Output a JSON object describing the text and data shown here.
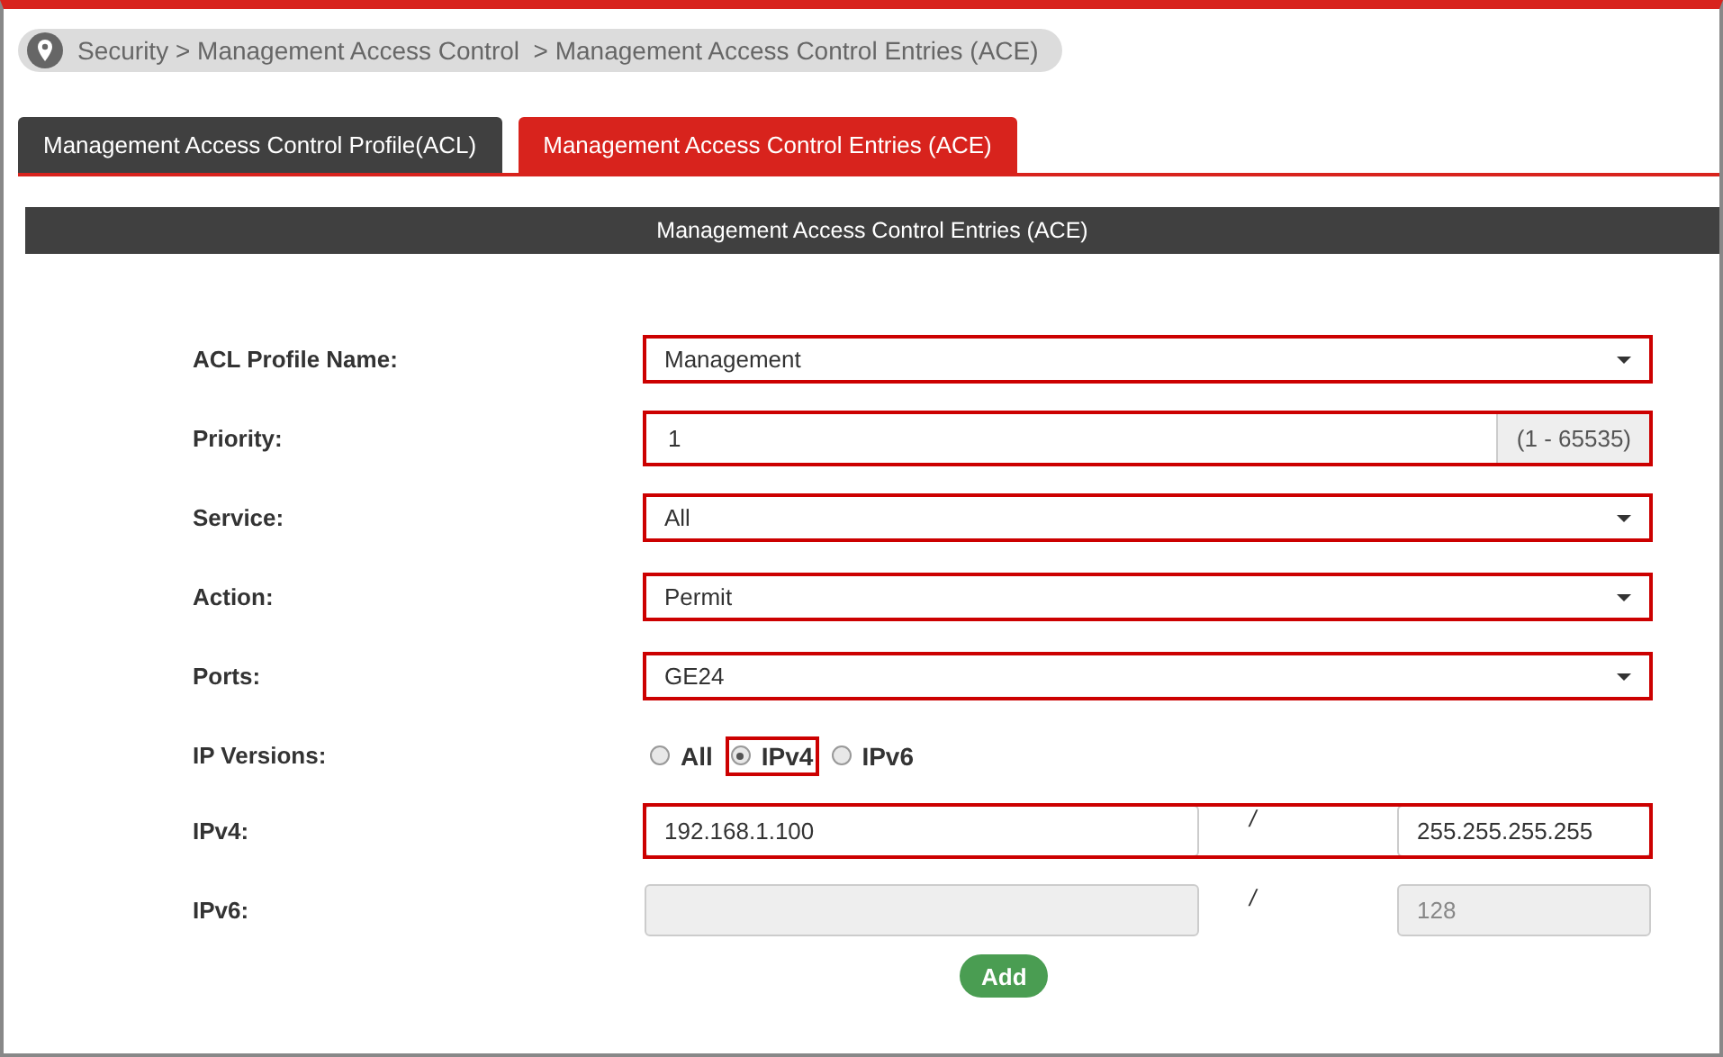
{
  "breadcrumb": "Security > Management Access Control  > Management Access Control Entries (ACE)",
  "tabs": [
    {
      "label": "Management Access Control Profile(ACL)",
      "selected": false
    },
    {
      "label": "Management Access Control Entries (ACE)",
      "selected": true
    }
  ],
  "panel": {
    "title": "Management Access Control Entries (ACE)"
  },
  "fields": [
    {
      "kind": "select",
      "label": "ACL Profile Name:",
      "value": "Management",
      "highlighted": true
    },
    {
      "kind": "addon-input",
      "label": "Priority:",
      "value": "1",
      "addon": "(1 - 65535)",
      "highlighted": true
    },
    {
      "kind": "select",
      "label": "Service:",
      "value": "All",
      "highlighted": true
    },
    {
      "kind": "select",
      "label": "Action:",
      "value": "Permit",
      "highlighted": true
    },
    {
      "kind": "select",
      "label": "Ports:",
      "value": "GE24",
      "highlighted": true
    },
    {
      "kind": "radios",
      "label": "IP Versions:",
      "options": [
        {
          "label": "All",
          "selected": false,
          "highlighted": false
        },
        {
          "label": "IPv4",
          "selected": true,
          "highlighted": true
        },
        {
          "label": "IPv6",
          "selected": false,
          "highlighted": false
        }
      ]
    },
    {
      "kind": "address-pair",
      "label": "IPv4:",
      "address": "192.168.1.100",
      "separator": "/",
      "mask": "255.255.255.255",
      "disabled": false,
      "highlighted": true
    },
    {
      "kind": "address-pair",
      "label": "IPv6:",
      "separator": "/",
      "mask": "128",
      "disabled": true,
      "highlighted": false
    }
  ],
  "add_button": "Add"
}
